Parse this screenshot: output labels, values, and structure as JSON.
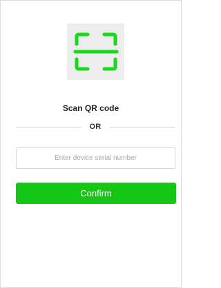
{
  "scan": {
    "icon": "qr-scan-icon",
    "label": "Scan QR code",
    "accent_color": "#1ad81a"
  },
  "divider": {
    "label": "OR"
  },
  "serial_input": {
    "placeholder": "Enter device serial number",
    "value": ""
  },
  "confirm": {
    "label": "Confirm",
    "color": "#15c615"
  }
}
